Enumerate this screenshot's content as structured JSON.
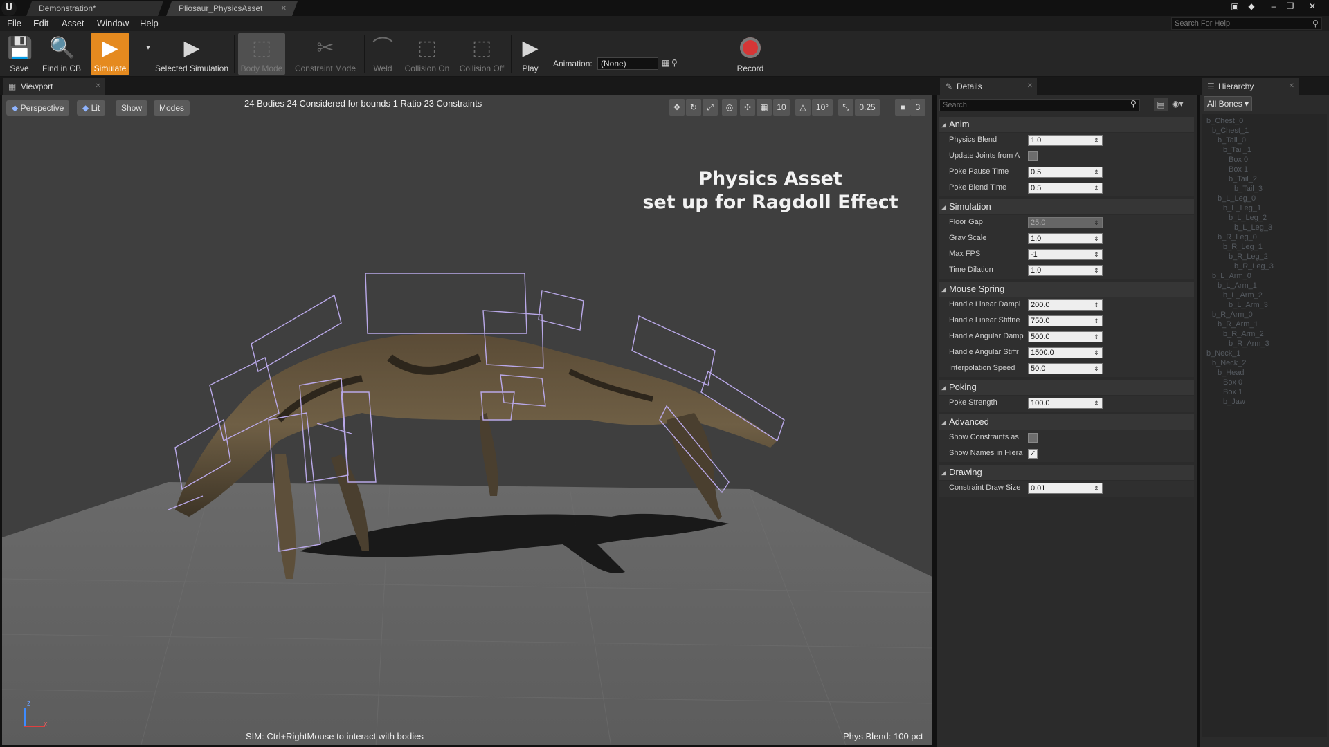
{
  "titlebar": {
    "tabs": [
      {
        "label": "Demonstration*"
      },
      {
        "label": "Pliosaur_PhysicsAsset"
      }
    ],
    "logo": "U"
  },
  "menubar": {
    "items": [
      "File",
      "Edit",
      "Asset",
      "Window",
      "Help"
    ],
    "search_placeholder": "Search For Help"
  },
  "toolbar": {
    "save": "Save",
    "find_in_cb": "Find in CB",
    "simulate": "Simulate",
    "selected_simulation": "Selected Simulation",
    "body_mode": "Body Mode",
    "constraint_mode": "Constraint Mode",
    "weld": "Weld",
    "collision_on": "Collision On",
    "collision_off": "Collision Off",
    "play": "Play",
    "animation_label": "Animation:",
    "animation_value": "(None)",
    "record": "Record"
  },
  "viewport": {
    "tab_label": "Viewport",
    "buttons": {
      "perspective": "Perspective",
      "lit": "Lit",
      "show": "Show",
      "modes": "Modes"
    },
    "stats": "24 Bodies  24 Considered for bounds  1 Ratio  23 Constraints",
    "grid_snap": "10",
    "rotate_snap": "10°",
    "scale_snap": "0.25",
    "camera_speed": "3",
    "overlay_title_line1": "Physics Asset",
    "overlay_title_line2": "set up for Ragdoll Effect",
    "hint": "SIM: Ctrl+RightMouse to interact with bodies",
    "phys_blend": "Phys Blend: 100 pct",
    "axis": {
      "z": "z",
      "x": "x"
    }
  },
  "details": {
    "tab_label": "Details",
    "search_placeholder": "Search",
    "categories": [
      {
        "name": "Anim",
        "props": [
          {
            "label": "Physics Blend",
            "type": "number",
            "value": "1.0"
          },
          {
            "label": "Update Joints from A",
            "type": "check",
            "value": "off"
          },
          {
            "label": "Poke Pause Time",
            "type": "number",
            "value": "0.5"
          },
          {
            "label": "Poke Blend Time",
            "type": "number",
            "value": "0.5"
          }
        ]
      },
      {
        "name": "Simulation",
        "props": [
          {
            "label": "Floor Gap",
            "type": "number",
            "value": "25.0",
            "disabled": true
          },
          {
            "label": "Grav Scale",
            "type": "number",
            "value": "1.0"
          },
          {
            "label": "Max FPS",
            "type": "number",
            "value": "-1"
          },
          {
            "label": "Time Dilation",
            "type": "number",
            "value": "1.0"
          }
        ]
      },
      {
        "name": "Mouse Spring",
        "props": [
          {
            "label": "Handle Linear Dampi",
            "type": "number",
            "value": "200.0"
          },
          {
            "label": "Handle Linear Stiffne",
            "type": "number",
            "value": "750.0"
          },
          {
            "label": "Handle Angular Damp",
            "type": "number",
            "value": "500.0"
          },
          {
            "label": "Handle Angular Stiffr",
            "type": "number",
            "value": "1500.0"
          },
          {
            "label": "Interpolation Speed",
            "type": "number",
            "value": "50.0"
          }
        ]
      },
      {
        "name": "Poking",
        "props": [
          {
            "label": "Poke Strength",
            "type": "number",
            "value": "100.0"
          }
        ]
      },
      {
        "name": "Advanced",
        "props": [
          {
            "label": "Show Constraints as",
            "type": "check",
            "value": "off"
          },
          {
            "label": "Show Names in Hiera",
            "type": "check",
            "value": "on"
          }
        ]
      },
      {
        "name": "Drawing",
        "props": [
          {
            "label": "Constraint Draw Size",
            "type": "number",
            "value": "0.01"
          }
        ]
      }
    ]
  },
  "hierarchy": {
    "tab_label": "Hierarchy",
    "dropdown": "All Bones",
    "items": [
      {
        "label": "b_Chest_0",
        "depth": 0
      },
      {
        "label": "b_Chest_1",
        "depth": 1
      },
      {
        "label": "b_Tail_0",
        "depth": 2
      },
      {
        "label": "b_Tail_1",
        "depth": 3
      },
      {
        "label": "Box 0",
        "depth": 4
      },
      {
        "label": "Box 1",
        "depth": 4
      },
      {
        "label": "b_Tail_2",
        "depth": 4
      },
      {
        "label": "b_Tail_3",
        "depth": 5
      },
      {
        "label": "b_L_Leg_0",
        "depth": 2
      },
      {
        "label": "b_L_Leg_1",
        "depth": 3
      },
      {
        "label": "b_L_Leg_2",
        "depth": 4
      },
      {
        "label": "b_L_Leg_3",
        "depth": 5
      },
      {
        "label": "b_R_Leg_0",
        "depth": 2
      },
      {
        "label": "b_R_Leg_1",
        "depth": 3
      },
      {
        "label": "b_R_Leg_2",
        "depth": 4
      },
      {
        "label": "b_R_Leg_3",
        "depth": 5
      },
      {
        "label": "b_L_Arm_0",
        "depth": 1
      },
      {
        "label": "b_L_Arm_1",
        "depth": 2
      },
      {
        "label": "b_L_Arm_2",
        "depth": 3
      },
      {
        "label": "b_L_Arm_3",
        "depth": 4
      },
      {
        "label": "b_R_Arm_0",
        "depth": 1
      },
      {
        "label": "b_R_Arm_1",
        "depth": 2
      },
      {
        "label": "b_R_Arm_2",
        "depth": 3
      },
      {
        "label": "b_R_Arm_3",
        "depth": 4
      },
      {
        "label": "b_Neck_1",
        "depth": 0
      },
      {
        "label": "b_Neck_2",
        "depth": 1
      },
      {
        "label": "b_Head",
        "depth": 2
      },
      {
        "label": "Box 0",
        "depth": 3
      },
      {
        "label": "Box 1",
        "depth": 3
      },
      {
        "label": "b_Jaw",
        "depth": 3
      }
    ]
  },
  "colors": {
    "simulate_active": "#e58a1f",
    "record": "#d63636",
    "panel_bg": "#2b2b2b",
    "viewport_bg": "#3f3f3f"
  }
}
